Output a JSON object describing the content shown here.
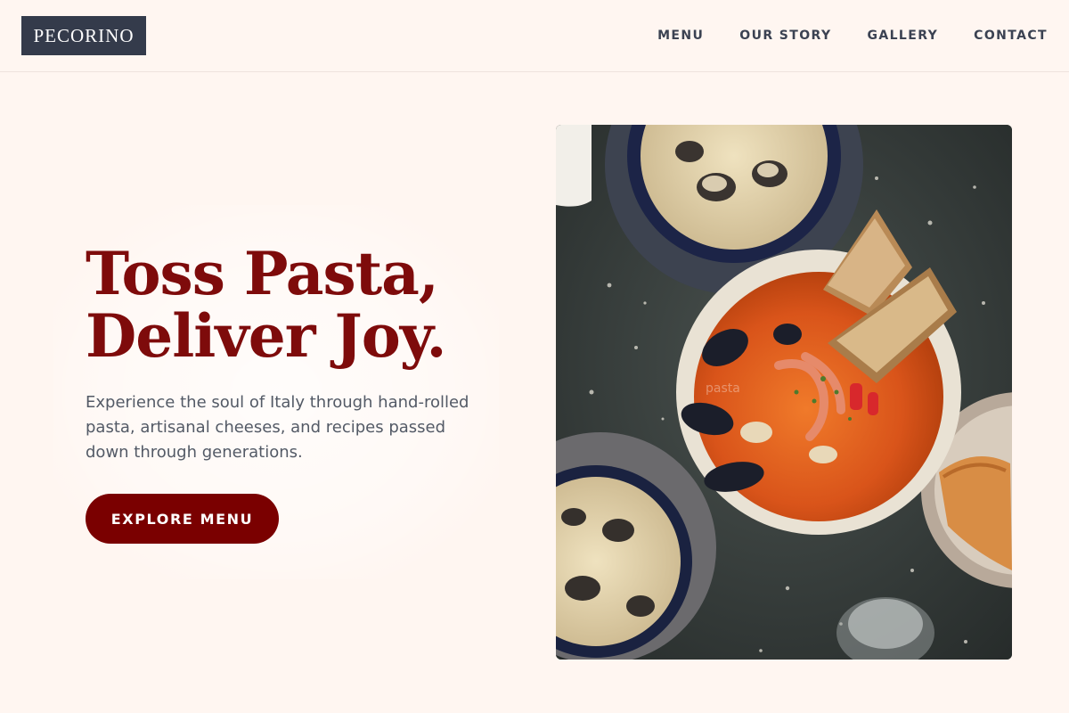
{
  "brand": {
    "name": "PECORINO"
  },
  "nav": {
    "items": [
      {
        "label": "MENU"
      },
      {
        "label": "OUR STORY"
      },
      {
        "label": "GALLERY"
      },
      {
        "label": "CONTACT"
      }
    ]
  },
  "hero": {
    "title_line1": "Toss Pasta,",
    "title_line2": "Deliver Joy.",
    "subtitle": "Experience the soul of Italy through hand-rolled pasta, artisanal cheeses, and recipes passed down through generations.",
    "cta_label": "EXPLORE MENU"
  },
  "photo": {
    "overlay_text": "pasta",
    "alt": "Seafood pasta dishes with mussels, clams, prawns and toasted bread on a dark terrazzo table"
  },
  "colors": {
    "background": "#fff6f1",
    "brand_dark": "#343b4b",
    "accent": "#7a0000",
    "heading": "#7e0b0b",
    "body_text": "#535a66"
  }
}
